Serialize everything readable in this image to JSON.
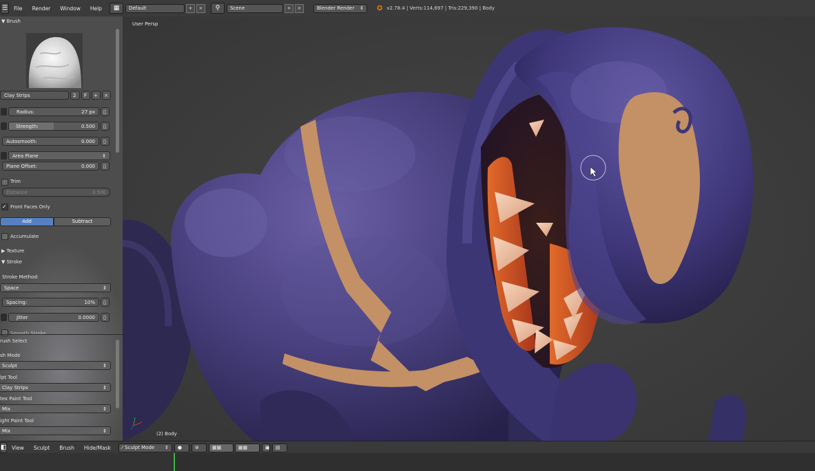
{
  "topbar": {
    "menus": [
      "File",
      "Render",
      "Window",
      "Help"
    ],
    "layout_value": "Default",
    "scene_value": "Scene",
    "render_engine": "Blender Render",
    "stats": "v2.78.4 | Verts:114,697 | Tris:229,390 | Body"
  },
  "toolpanel": {
    "brush_header": "▼ Brush",
    "brush_name": "Clay Strips",
    "brush_users": "2",
    "brush_fake": "F",
    "radius_label": "Radius:",
    "radius_value": "27 px",
    "strength_label": "Strength:",
    "strength_value": "0.500",
    "strength_fill": 0.5,
    "autosmooth_label": "Autosmooth:",
    "autosmooth_value": "0.000",
    "plane_select": "Area Plane",
    "plane_offset_label": "Plane Offset:",
    "plane_offset_value": "0.000",
    "trim_label": "Trim",
    "distance_label": "Distance",
    "distance_value": "0.500",
    "front_faces_label": "Front Faces Only",
    "add_label": "Add",
    "subtract_label": "Subtract",
    "accumulate_label": "Accumulate",
    "texture_header": "▶ Texture",
    "stroke_header": "▼ Stroke",
    "stroke_method_label": "Stroke Method:",
    "stroke_method_value": "Space",
    "spacing_label": "Spacing:",
    "spacing_value": "10%",
    "jitter_label": "Jitter",
    "jitter_value": "0.0000",
    "smooth_stroke_label": "Smooth Stroke",
    "brush_select_header": "rush Select",
    "mode_label": "sh Mode",
    "mode_value": "Sculpt",
    "sculpt_tool_label": "lpt Tool",
    "sculpt_tool_value": "Clay Strips",
    "vertex_paint_label": "tex Paint Tool",
    "vertex_paint_value": "Mix",
    "weight_paint_label": "ight Paint Tool",
    "weight_paint_value": "Mix"
  },
  "viewport": {
    "view_label": "User Persp",
    "object_label": "(2) Body"
  },
  "bottombar": {
    "menus": [
      "View",
      "Sculpt",
      "Brush",
      "Hide/Mask"
    ],
    "mode": "Sculpt Mode"
  }
}
